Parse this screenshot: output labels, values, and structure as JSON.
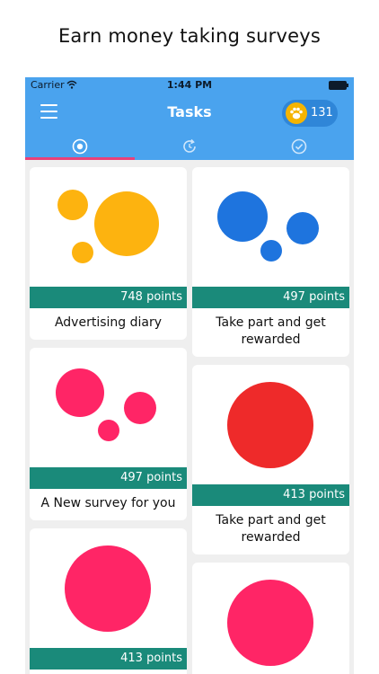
{
  "headline": "Earn money taking surveys",
  "status": {
    "carrier": "Carrier",
    "time": "1:44 PM"
  },
  "nav": {
    "title": "Tasks",
    "points": "131"
  },
  "icons": {
    "menu": "menu-icon",
    "paw": "paw-icon",
    "wifi": "wifi-icon",
    "battery": "battery-icon",
    "tabs": [
      "target-icon",
      "refresh-icon",
      "check-circle-icon"
    ]
  },
  "colors": {
    "nav_bg": "#4aa3ee",
    "points_bar": "#1a8a7a",
    "tab_indicator": "#e8417a",
    "yellow": "#fdb30f",
    "blue": "#1e74de",
    "pink": "#ff2566",
    "red": "#ee2a2a"
  },
  "cards": [
    {
      "points": "748 points",
      "title": "Advertising diary",
      "art_color": "#fdb30f"
    },
    {
      "points": "497 points",
      "title": "Take part and get rewarded",
      "art_color": "#1e74de"
    },
    {
      "points": "497 points",
      "title": "A New survey for you",
      "art_color": "#ff2566"
    },
    {
      "points": "413 points",
      "title": "Take part and get rewarded",
      "art_color": "#ee2a2a"
    },
    {
      "points": "413 points",
      "title": "",
      "art_color": "#ff2566"
    },
    {
      "points": "",
      "title": "",
      "art_color": "#ff2566"
    }
  ]
}
